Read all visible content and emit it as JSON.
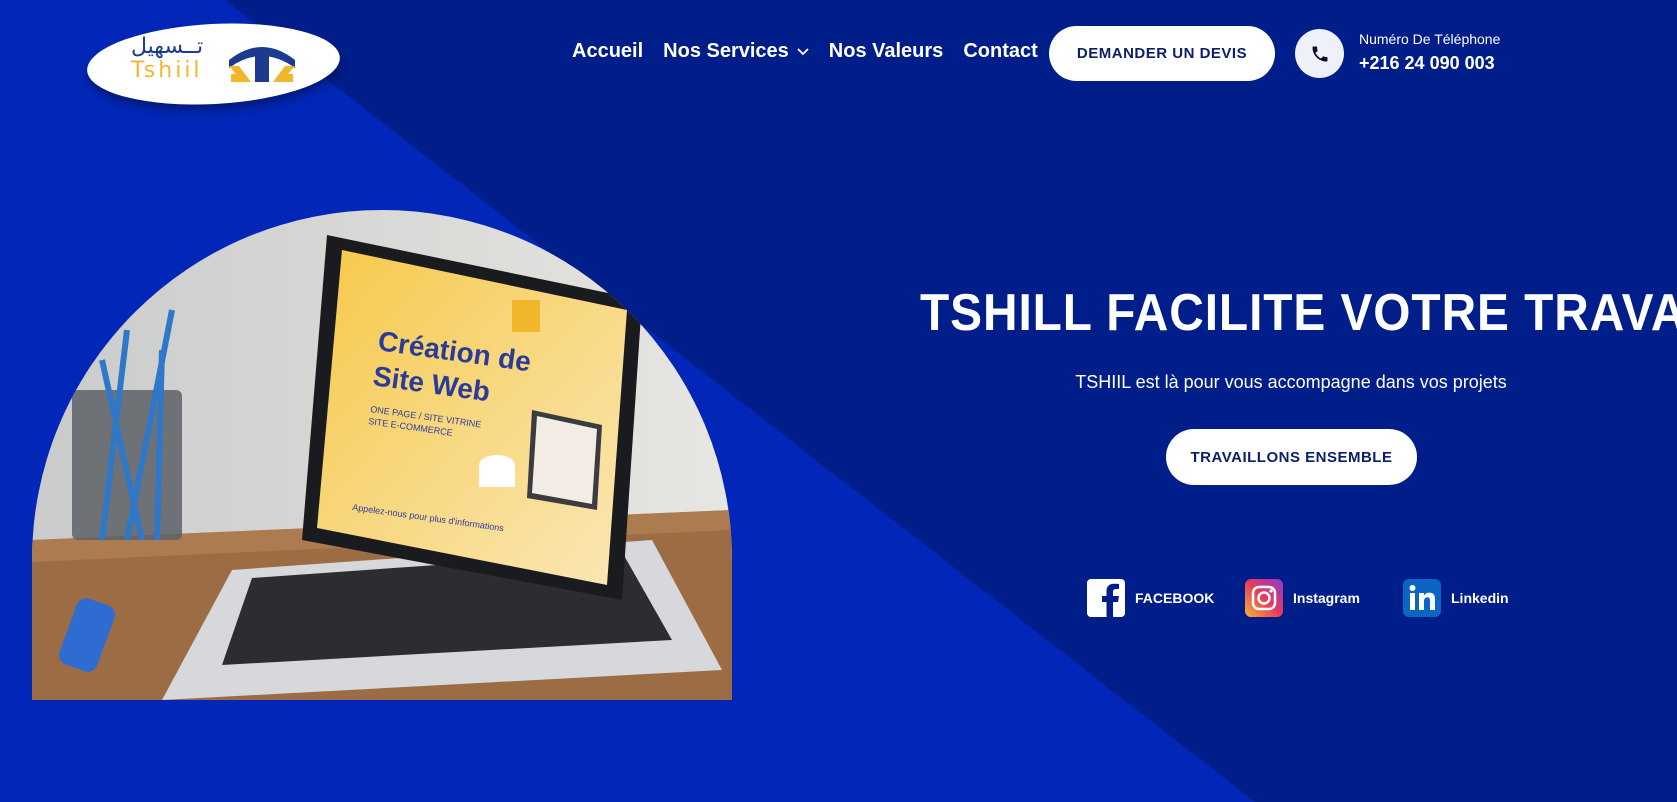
{
  "colors": {
    "background": "#001e8a",
    "diagonal": "#0227b8",
    "button_bg": "#ffffff",
    "button_text": "#0b1f6b",
    "logo_blue": "#1c3b8f",
    "logo_gold": "#f2b62c"
  },
  "logo": {
    "arabic_text": "تــسهيل",
    "latin_text": "Tshiil",
    "icon": "tshiil-logo-mark"
  },
  "nav": {
    "items": [
      {
        "label": "Accueil"
      },
      {
        "label": "Nos Services",
        "icon": "chevron-down-icon"
      },
      {
        "label": "Nos Valeurs"
      },
      {
        "label": "Contact"
      }
    ],
    "cta_label": "DEMANDER UN DEVIS",
    "phone": {
      "icon": "phone-icon",
      "label": "Numéro De Téléphone",
      "number": "+216 24 090 003"
    }
  },
  "hero": {
    "image": {
      "heading_line1": "Création de",
      "heading_line2": "Site Web",
      "subtext_line1": "ONE PAGE / SITE VITRINE",
      "subtext_line2": "SITE E-COMMERCE",
      "footer_text": "Appelez-nous pour plus d'informations"
    },
    "title": "TSHILL FACILITE VOTRE TRAVAIL",
    "subtitle": "TSHIIL est là pour vous accompagne dans vos projets",
    "cta_label": "TRAVAILLONS ENSEMBLE"
  },
  "socials": [
    {
      "label": "FACEBOOK",
      "icon": "facebook-icon"
    },
    {
      "label": "Instagram",
      "icon": "instagram-icon"
    },
    {
      "label": "Linkedin",
      "icon": "linkedin-icon"
    }
  ]
}
